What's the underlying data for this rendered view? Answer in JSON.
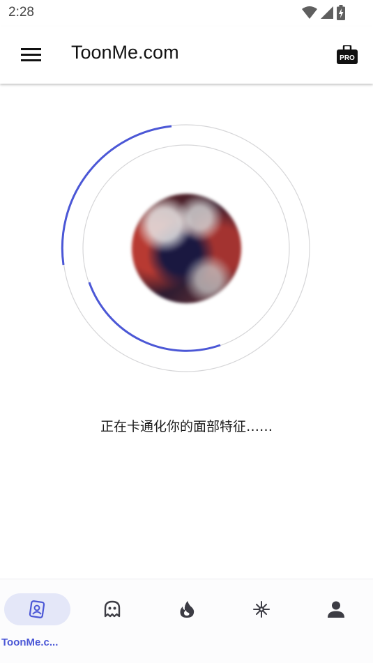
{
  "status_bar": {
    "time": "2:28",
    "icons": [
      "wifi-icon",
      "signal-icon",
      "battery-charging-icon"
    ]
  },
  "app_bar": {
    "title": "ToonMe.com",
    "menu_icon": "hamburger-menu-icon",
    "pro_icon": "pro-briefcase-icon",
    "pro_label": "PRO"
  },
  "progress": {
    "message": "正在卡通化你的面部特征……",
    "accent_color": "#4b57d6",
    "track_color": "#d6d6d8"
  },
  "bottom_nav": {
    "items": [
      {
        "label": "ToonMe.c...",
        "icon": "toon-portrait-icon",
        "active": true
      },
      {
        "label": "",
        "icon": "ghost-icon",
        "active": false
      },
      {
        "label": "",
        "icon": "flame-icon",
        "active": false
      },
      {
        "label": "",
        "icon": "sparkle-icon",
        "active": false
      },
      {
        "label": "",
        "icon": "person-icon",
        "active": false
      }
    ]
  }
}
